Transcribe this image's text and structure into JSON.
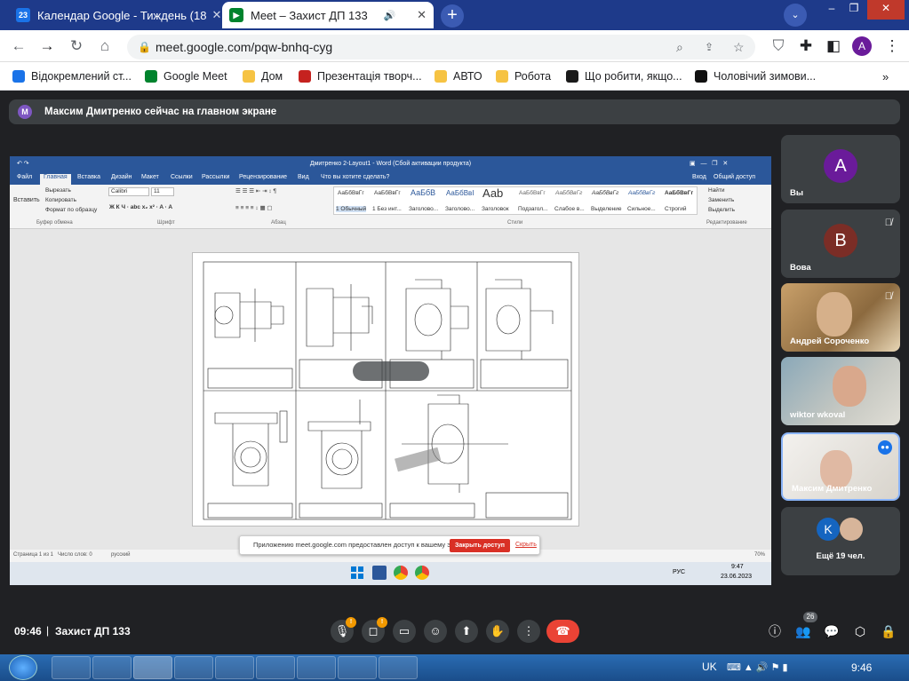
{
  "browser": {
    "tabs": [
      {
        "label": "Календар Google - Тиждень (18",
        "favicon": "calendar-icon",
        "active": false
      },
      {
        "label": "Meet – Захист ДП 133",
        "favicon": "meet-icon",
        "active": true
      }
    ],
    "url": "meet.google.com/pqw-bnhq-cyg",
    "profile_letter": "A",
    "bookmarks": [
      "Відокремлений ст...",
      "Google Meet",
      "Дом",
      "Презентація творч...",
      "АВТО",
      "Робота",
      "Що робити, якщо...",
      "Чоловічий зимови..."
    ]
  },
  "meet": {
    "presenting_banner": "Максим Дмитренко сейчас на главном экране",
    "presenter_initial": "М",
    "participants": [
      {
        "initial": "A",
        "name": "Вы",
        "color": "#6a1b9a"
      },
      {
        "initial": "B",
        "name": "Вова",
        "color": "#7b2d26"
      },
      {
        "name": "Андрей Сороченко"
      },
      {
        "name": "wiktor wkoval"
      },
      {
        "name": "Максим Дмитренко"
      },
      {
        "initial": "K",
        "name": "Ещё 19 чел."
      }
    ],
    "time": "09:46",
    "meeting_title": "Захист ДП 133",
    "people_count": "26",
    "mic_badge": "!",
    "cam_badge": "!"
  },
  "shared_screen": {
    "word_title": "Дмитренко 2-Layout1 - Word (Сбой активации продукта)",
    "ribbon_tabs": [
      "Файл",
      "Главная",
      "Вставка",
      "Дизайн",
      "Макет",
      "Ссылки",
      "Рассылки",
      "Рецензирование",
      "Вид"
    ],
    "tell_me": "Что вы хотите сделать?",
    "sign_in": "Вход",
    "share": "Общий доступ",
    "font_name": "Calibri",
    "font_size": "11",
    "clipboard": [
      "Вставить",
      "Вырезать",
      "Копировать",
      "Формат по образцу"
    ],
    "group_labels": [
      "Буфер обмена",
      "Шрифт",
      "Абзац",
      "Стили",
      "Редактирование"
    ],
    "styles": [
      "1 Обычный",
      "1 Без инт...",
      "Заголово...",
      "Заголово...",
      "Заголовок",
      "Подзагол...",
      "Слабое в...",
      "Выделение",
      "Сильное...",
      "Строгий"
    ],
    "editing": [
      "Найти",
      "Заменить",
      "Выделить"
    ],
    "status": [
      "Страница 1 из 1",
      "Число слов: 0",
      "русский"
    ],
    "zoom": "70%",
    "share_notice": "Приложению meet.google.com предоставлен доступ к вашему экрану.",
    "stop_button": "Закрыть доступ",
    "hide_link": "Скрыть",
    "clock_time": "9:47",
    "clock_date": "23.06.2023",
    "lang": "РУС"
  },
  "windows": {
    "lang": "UK",
    "time": "9:46"
  }
}
